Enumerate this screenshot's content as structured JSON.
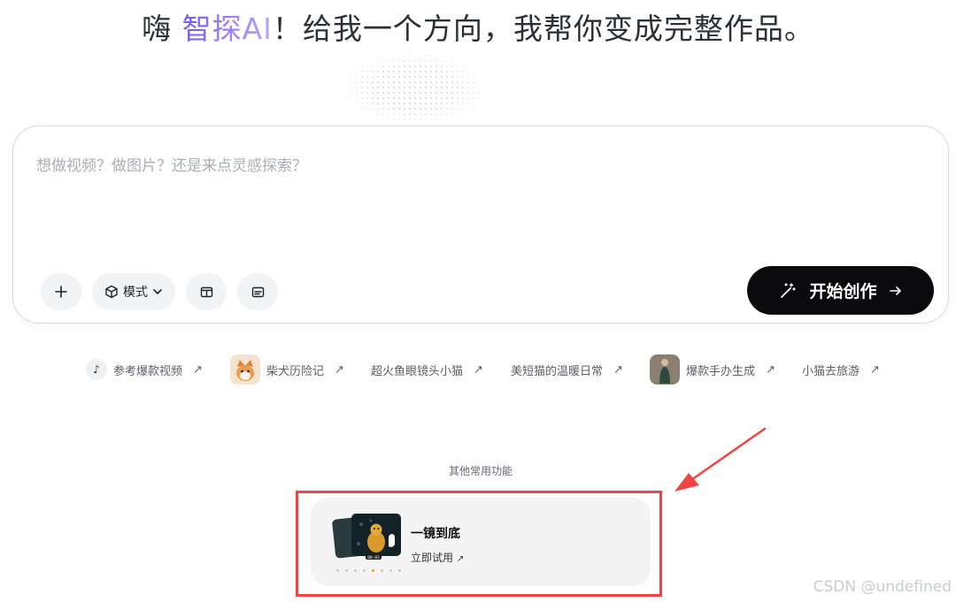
{
  "headline": {
    "prefix": "嗨 ",
    "brand": "智探AI",
    "suffix": "！给我一个方向，我帮你变成完整作品。"
  },
  "composer": {
    "placeholder": "想做视频？做图片？还是来点灵感探索？",
    "mode_label": "模式",
    "start_label": "开始创作"
  },
  "chips": [
    {
      "label": "参考爆款视频",
      "icon": "tiktok-icon"
    },
    {
      "label": "柴犬历险记",
      "icon": "shiba-thumbnail"
    },
    {
      "label": "超火鱼眼镜头小猫",
      "icon": ""
    },
    {
      "label": "美短猫的温暖日常",
      "icon": ""
    },
    {
      "label": "爆款手办生成",
      "icon": "figure-thumbnail"
    },
    {
      "label": "小猫去旅游",
      "icon": ""
    }
  ],
  "other_features": {
    "title": "其他常用功能",
    "card": {
      "title": "一镜到底",
      "action": "立即试用",
      "time_tag": "00:03"
    }
  },
  "watermark": "CSDN @undefined",
  "colors": {
    "brand_gradient": [
      "#6d5cf0",
      "#b9a8ff"
    ],
    "start_button": "#0b0b0d",
    "highlight": "#ef4444"
  }
}
